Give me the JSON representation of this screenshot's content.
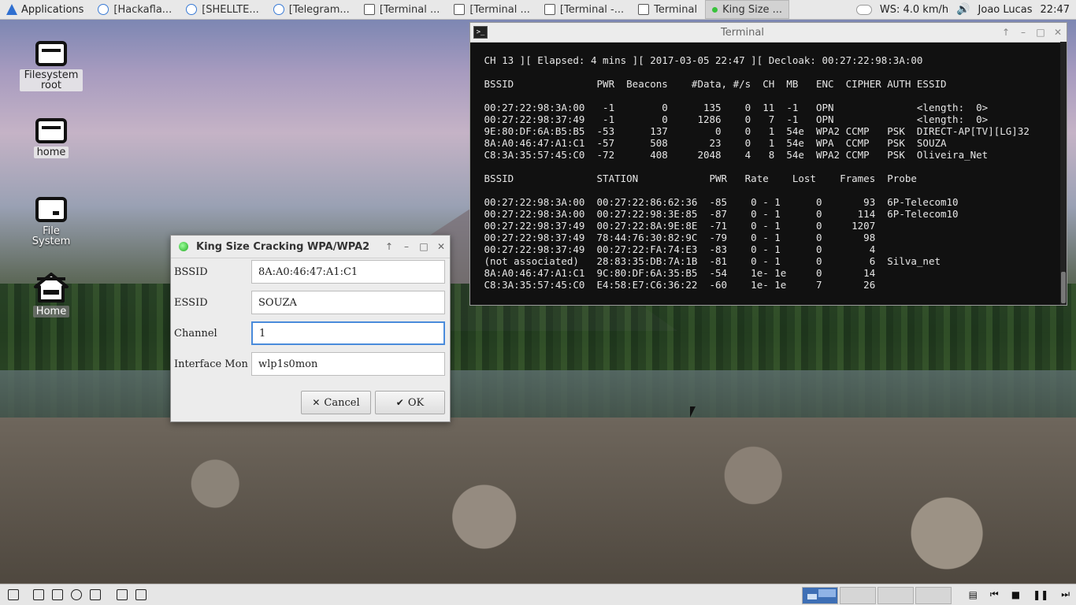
{
  "top_panel": {
    "applications_label": "Applications",
    "tasks": [
      {
        "label": "[Hackafla...",
        "icon": "browser-icon"
      },
      {
        "label": "[SHELLTE...",
        "icon": "browser-icon"
      },
      {
        "label": "[Telegram...",
        "icon": "telegram-icon"
      },
      {
        "label": "[Terminal ...",
        "icon": "terminal-icon"
      },
      {
        "label": "[Terminal ...",
        "icon": "terminal-icon"
      },
      {
        "label": "[Terminal -...",
        "icon": "terminal-icon"
      },
      {
        "label": "Terminal",
        "icon": "terminal-icon"
      },
      {
        "label": "King Size ...",
        "icon": "green-dot-icon",
        "active": true
      }
    ],
    "weather": "WS: 4.0 km/h",
    "user": "Joao Lucas",
    "clock": "22:47"
  },
  "desktop_icons": [
    {
      "label": "Filesystem root",
      "icon": "drive-icon"
    },
    {
      "label": "home",
      "icon": "drive-icon"
    },
    {
      "label": "File System",
      "icon": "removable-drive-icon"
    },
    {
      "label": "Home",
      "icon": "home-icon"
    }
  ],
  "terminal": {
    "title": "Terminal",
    "lines": [
      " CH 13 ][ Elapsed: 4 mins ][ 2017-03-05 22:47 ][ Decloak: 00:27:22:98:3A:00",
      "",
      " BSSID              PWR  Beacons    #Data, #/s  CH  MB   ENC  CIPHER AUTH ESSID",
      "",
      " 00:27:22:98:3A:00   -1        0      135    0  11  -1   OPN              <length:  0>",
      " 00:27:22:98:37:49   -1        0     1286    0   7  -1   OPN              <length:  0>",
      " 9E:80:DF:6A:B5:B5  -53      137        0    0   1  54e  WPA2 CCMP   PSK  DIRECT-AP[TV][LG]32",
      " 8A:A0:46:47:A1:C1  -57      508       23    0   1  54e  WPA  CCMP   PSK  SOUZA",
      " C8:3A:35:57:45:C0  -72      408     2048    4   8  54e  WPA2 CCMP   PSK  Oliveira_Net",
      "",
      " BSSID              STATION            PWR   Rate    Lost    Frames  Probe",
      "",
      " 00:27:22:98:3A:00  00:27:22:86:62:36  -85    0 - 1      0       93  6P-Telecom10",
      " 00:27:22:98:3A:00  00:27:22:98:3E:85  -87    0 - 1      0      114  6P-Telecom10",
      " 00:27:22:98:37:49  00:27:22:8A:9E:8E  -71    0 - 1      0     1207",
      " 00:27:22:98:37:49  78:44:76:30:82:9C  -79    0 - 1      0       98",
      " 00:27:22:98:37:49  00:27:22:FA:74:E3  -83    0 - 1      0        4",
      " (not associated)   28:83:35:DB:7A:1B  -81    0 - 1      0        6  Silva_net",
      " 8A:A0:46:47:A1:C1  9C:80:DF:6A:35:B5  -54    1e- 1e     0       14",
      " C8:3A:35:57:45:C0  E4:58:E7:C6:36:22  -60    1e- 1e     7       26"
    ]
  },
  "dialog": {
    "title": "King Size Cracking WPA/WPA2",
    "fields": [
      {
        "label": "BSSID",
        "value": "8A:A0:46:47:A1:C1"
      },
      {
        "label": "ESSID",
        "value": "SOUZA"
      },
      {
        "label": "Channel",
        "value": "1"
      },
      {
        "label": "Interface Mon",
        "value": "wlp1s0mon"
      }
    ],
    "cancel_label": "Cancel",
    "ok_label": "OK"
  }
}
